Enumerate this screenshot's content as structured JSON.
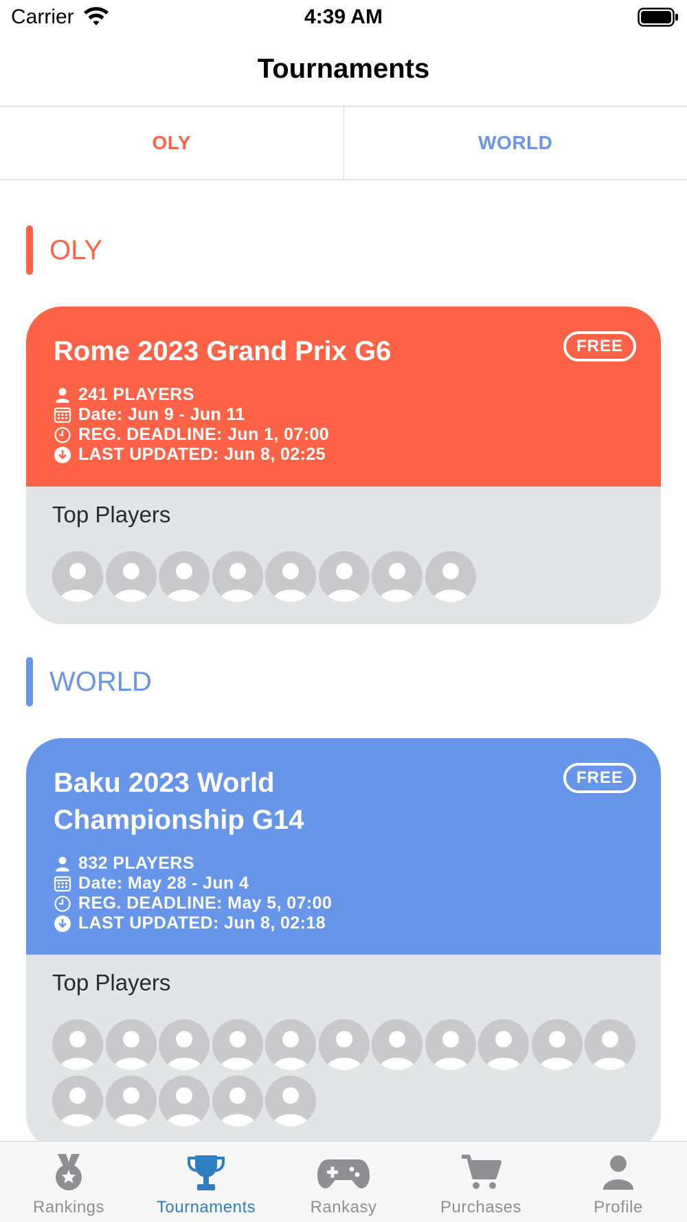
{
  "status_bar": {
    "carrier": "Carrier",
    "time": "4:39 AM"
  },
  "nav": {
    "title": "Tournaments"
  },
  "tabs": [
    {
      "label": "OLY",
      "color": "#ff6347"
    },
    {
      "label": "WORLD",
      "color": "#6695ea"
    }
  ],
  "sections": [
    {
      "title": "OLY",
      "color": "#ff6347",
      "card": {
        "title": "Rome 2023 Grand Prix G6",
        "badge": "FREE",
        "players": "241 PLAYERS",
        "date": "Date: Jun 9 - Jun 11",
        "deadline": "REG. DEADLINE: Jun 1, 07:00",
        "updated": "LAST UPDATED: Jun 8, 02:25",
        "top_players_label": "Top Players",
        "avatar_count": 8
      }
    },
    {
      "title": "WORLD",
      "color": "#6695ea",
      "card": {
        "title": "Baku 2023 World Championship G14",
        "badge": "FREE",
        "players": "832 PLAYERS",
        "date": "Date: May 28 - Jun 4",
        "deadline": "REG. DEADLINE: May 5, 07:00",
        "updated": "LAST UPDATED: Jun 8, 02:18",
        "top_players_label": "Top Players",
        "avatar_count": 16
      }
    }
  ],
  "tab_bar": [
    {
      "label": "Rankings",
      "icon": "medal-icon",
      "active": false
    },
    {
      "label": "Tournaments",
      "icon": "trophy-icon",
      "active": true
    },
    {
      "label": "Rankasy",
      "icon": "gamepad-icon",
      "active": false
    },
    {
      "label": "Purchases",
      "icon": "cart-icon",
      "active": false
    },
    {
      "label": "Profile",
      "icon": "person-icon",
      "active": false
    }
  ],
  "colors": {
    "accent_active": "#2f7ec1",
    "inactive": "#8e8e93",
    "card_body": "#e3e4e6"
  }
}
